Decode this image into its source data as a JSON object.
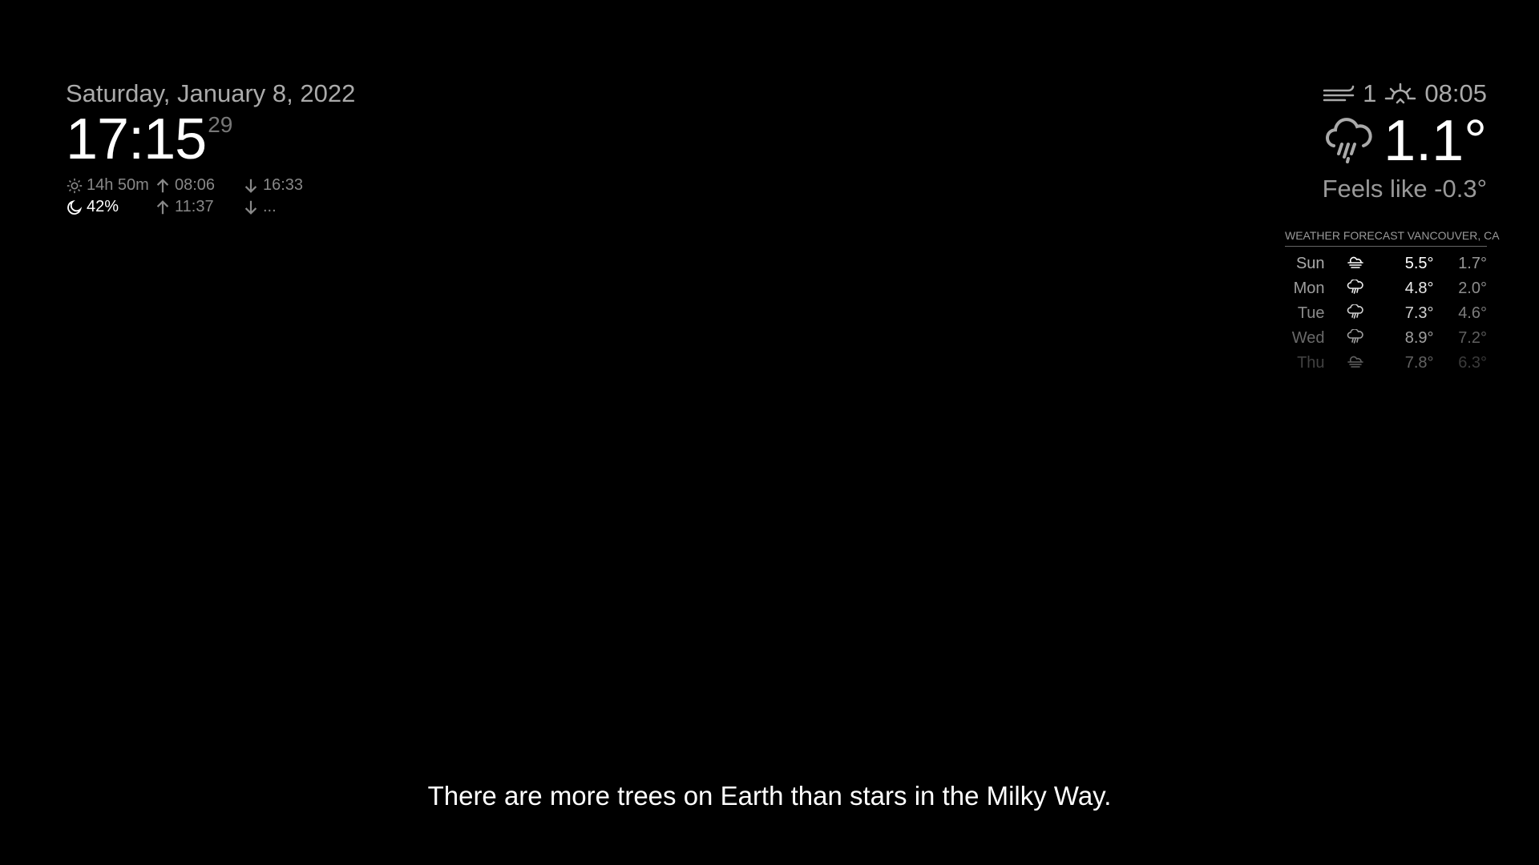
{
  "clock": {
    "date": "Saturday, January 8, 2022",
    "time": "17:15",
    "seconds": "29",
    "day_length": "14h 50m",
    "sunrise": "08:06",
    "sunset": "16:33",
    "moon_illumination": "42%",
    "moonrise": "11:37",
    "moonset": "..."
  },
  "current_weather": {
    "wind_speed": "1",
    "sunrise_time": "08:05",
    "temperature": "1.1°",
    "feels_like": "Feels like -0.3°",
    "icon": "rain-cloud-icon"
  },
  "forecast": {
    "header": "WEATHER FORECAST VANCOUVER, CA",
    "days": [
      {
        "day": "Sun",
        "icon": "cloudy-windy-icon",
        "max": "5.5°",
        "min": "1.7°"
      },
      {
        "day": "Mon",
        "icon": "rain-icon",
        "max": "4.8°",
        "min": "2.0°"
      },
      {
        "day": "Tue",
        "icon": "rain-icon",
        "max": "7.3°",
        "min": "4.6°"
      },
      {
        "day": "Wed",
        "icon": "rain-icon",
        "max": "8.9°",
        "min": "7.2°"
      },
      {
        "day": "Thu",
        "icon": "cloudy-windy-icon",
        "max": "7.8°",
        "min": "6.3°"
      }
    ]
  },
  "compliment": {
    "text": "There are more trees on Earth than stars in the Milky Way."
  },
  "colors": {
    "background": "#000000",
    "bright": "#ffffff",
    "normal": "#aaaaaa",
    "dimmed": "#888888"
  }
}
